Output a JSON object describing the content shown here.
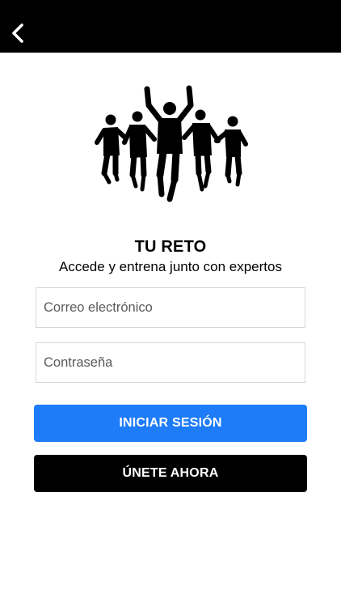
{
  "nav": {
    "back_icon": "chevron-left-icon"
  },
  "logo": {
    "icon": "runners-group-silhouette"
  },
  "header": {
    "title": "TU RETO",
    "subtitle": "Accede y entrena junto con expertos"
  },
  "form": {
    "email": {
      "value": "",
      "placeholder": "Correo electrónico"
    },
    "password": {
      "value": "",
      "placeholder": "Contraseña"
    }
  },
  "actions": {
    "login_label": "INICIAR SESIÓN",
    "join_label": "ÚNETE AHORA"
  },
  "colors": {
    "topbar": "#000000",
    "primary": "#1e7cf9",
    "secondary": "#000000",
    "border": "#d6d6d6"
  }
}
